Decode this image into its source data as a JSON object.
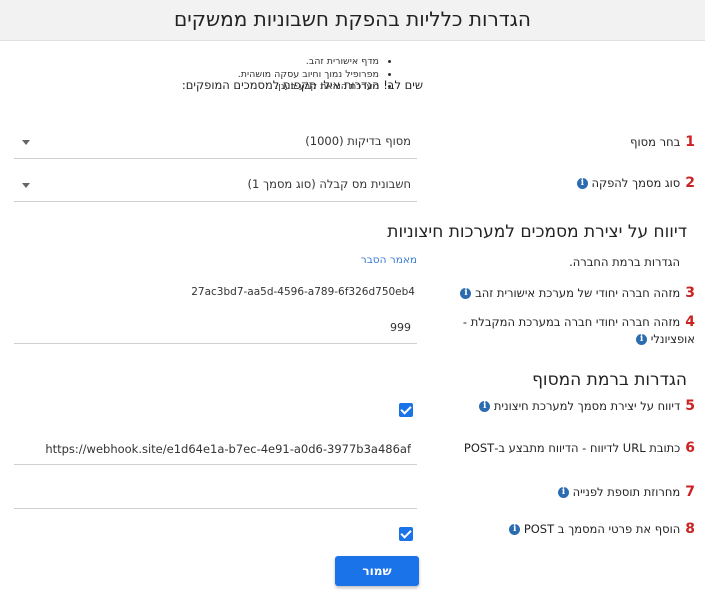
{
  "page": {
    "title": "הגדרות כלליות בהפקת חשבוניות ממשקים"
  },
  "note": {
    "text": "שים לב! הגדרות אילו תקפות למסמכים המופקים:",
    "bullets": [
      "מדף אישורית זהב.",
      "מפרופיל נמוך וחיוב עסקה מושהית.",
      "מערכת הוראת קבע בענן."
    ]
  },
  "terminal": {
    "number": "1",
    "label": "בחר מסוף",
    "value": "מסוף בדיקות  (1000)"
  },
  "doc_type": {
    "number": "2",
    "label": "סוג מסמך להפקה",
    "value": "חשבונית מס קבלה (סוג מסמך 1)"
  },
  "external_section": {
    "title": "דיווח על יצירת מסמכים למערכות חיצוניות",
    "company_level": "הגדרות ברמת החברה.",
    "explain_link": "מאמר הסבר"
  },
  "gold_company_id": {
    "number": "3",
    "label": "מזהה חברה יחודי של מערכת אישורית זהב",
    "value": "27ac3bd7-aa5d-4596-a789-6f326d750eb4"
  },
  "receiving_company_id": {
    "number": "4",
    "label_line1": "מזהה חברה יחודי חברה במערכת המקבלת -",
    "label_line2": "אופציונלי",
    "value": "999"
  },
  "terminal_section": {
    "title": "הגדרות ברמת המסוף"
  },
  "report_external": {
    "number": "5",
    "label": "דיווח על יצירת מסמך למערכת חיצונית"
  },
  "webhook_url": {
    "number": "6",
    "label": "כתובת URL לדיווח - הדיווח מתבצע ב-POST",
    "value": "https://webhook.site/e1d64e1a-b7ec-4e91-a0d6-3977b3a486af"
  },
  "prefix_string": {
    "number": "7",
    "label": "מחרוזת תוספת לפנייה",
    "value": ""
  },
  "add_doc_details": {
    "number": "8",
    "label": "הוסף את פרטי המסמך ב POST"
  },
  "save_button": {
    "label": "שמור"
  },
  "colors": {
    "accent": "#1a73e8",
    "number_red": "#cc2222",
    "info_blue": "#2b6cb0",
    "link": "#3a7bd5"
  }
}
